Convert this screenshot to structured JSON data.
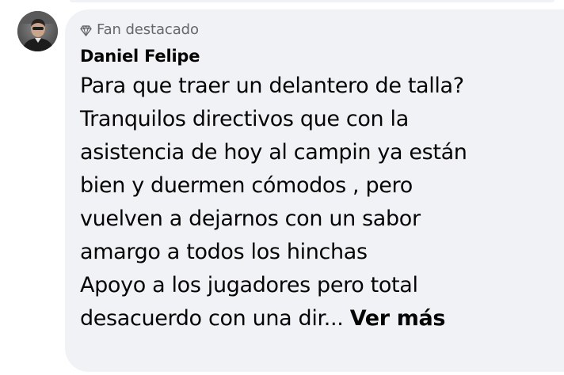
{
  "comment": {
    "badge_label": "Fan destacado",
    "badge_icon": "diamond-icon",
    "author": "Daniel Felipe",
    "lines": [
      "Para que traer un delantero de talla?",
      "Tranquilos directivos que con la",
      "asistencia de hoy al campin ya están",
      "bien y duermen cómodos , pero",
      "vuelven a dejarnos con un sabor",
      "amargo a todos los hinchas",
      "Apoyo a los jugadores pero total"
    ],
    "last_line": "desacuerdo con una dir...",
    "see_more": "Ver más"
  },
  "colors": {
    "bubble_bg": "#f0f2f5",
    "text_primary": "#050505",
    "text_secondary": "#65676b"
  }
}
